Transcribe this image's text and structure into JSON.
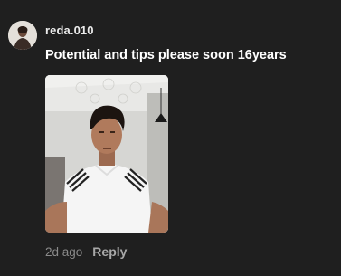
{
  "comment": {
    "username": "reda.010",
    "text": "Potential and tips please soon 16years",
    "time": "2d ago",
    "reply_label": "Reply"
  },
  "icons": {
    "avatar": "user-avatar-photo",
    "attachment": "attached-selfie-photo"
  }
}
